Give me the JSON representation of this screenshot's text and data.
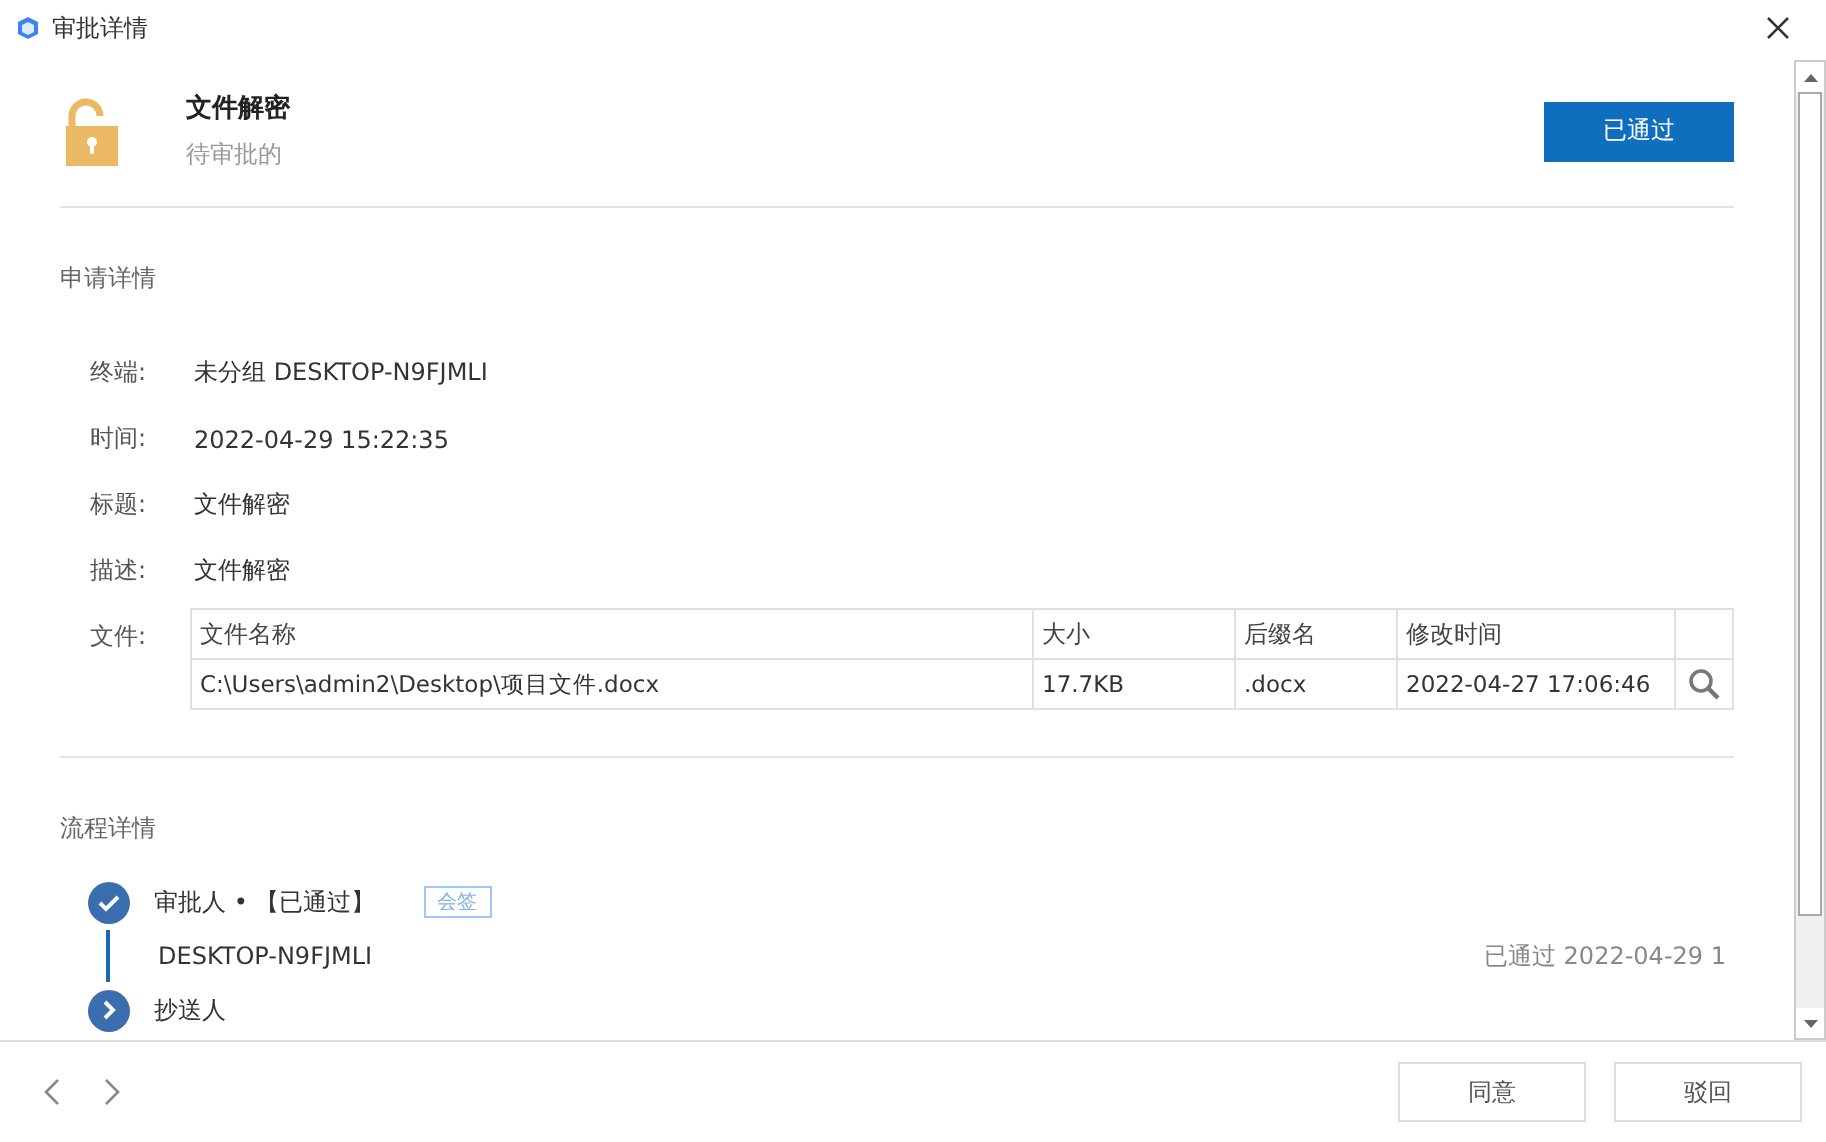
{
  "window": {
    "title": "审批详情"
  },
  "header": {
    "title": "文件解密",
    "subtitle": "待审批的",
    "status_button": "已通过"
  },
  "application": {
    "heading": "申请详情",
    "fields": [
      {
        "label": "终端:",
        "value": "未分组 DESKTOP-N9FJMLI"
      },
      {
        "label": "时间:",
        "value": "2022-04-29 15:22:35"
      },
      {
        "label": "标题:",
        "value": "文件解密"
      },
      {
        "label": "描述:",
        "value": "文件解密"
      }
    ],
    "files_label": "文件:",
    "table": {
      "columns": [
        "文件名称",
        "大小",
        "后缀名",
        "修改时间"
      ],
      "rows": [
        [
          "C:\\Users\\admin2\\Desktop\\项目文件.docx",
          "17.7KB",
          ".docx",
          "2022-04-27 17:06:46"
        ]
      ]
    }
  },
  "process": {
    "heading": "流程详情",
    "steps": [
      {
        "kind": "done",
        "title": "审批人 • 【已通过】",
        "tag": "会签",
        "children": [
          {
            "name": "DESKTOP-N9FJMLI",
            "result": "已通过 2022-04-29 1"
          }
        ]
      },
      {
        "kind": "pending",
        "title": "抄送人"
      }
    ]
  },
  "footer": {
    "buttons": [
      "同意",
      "驳回"
    ]
  }
}
